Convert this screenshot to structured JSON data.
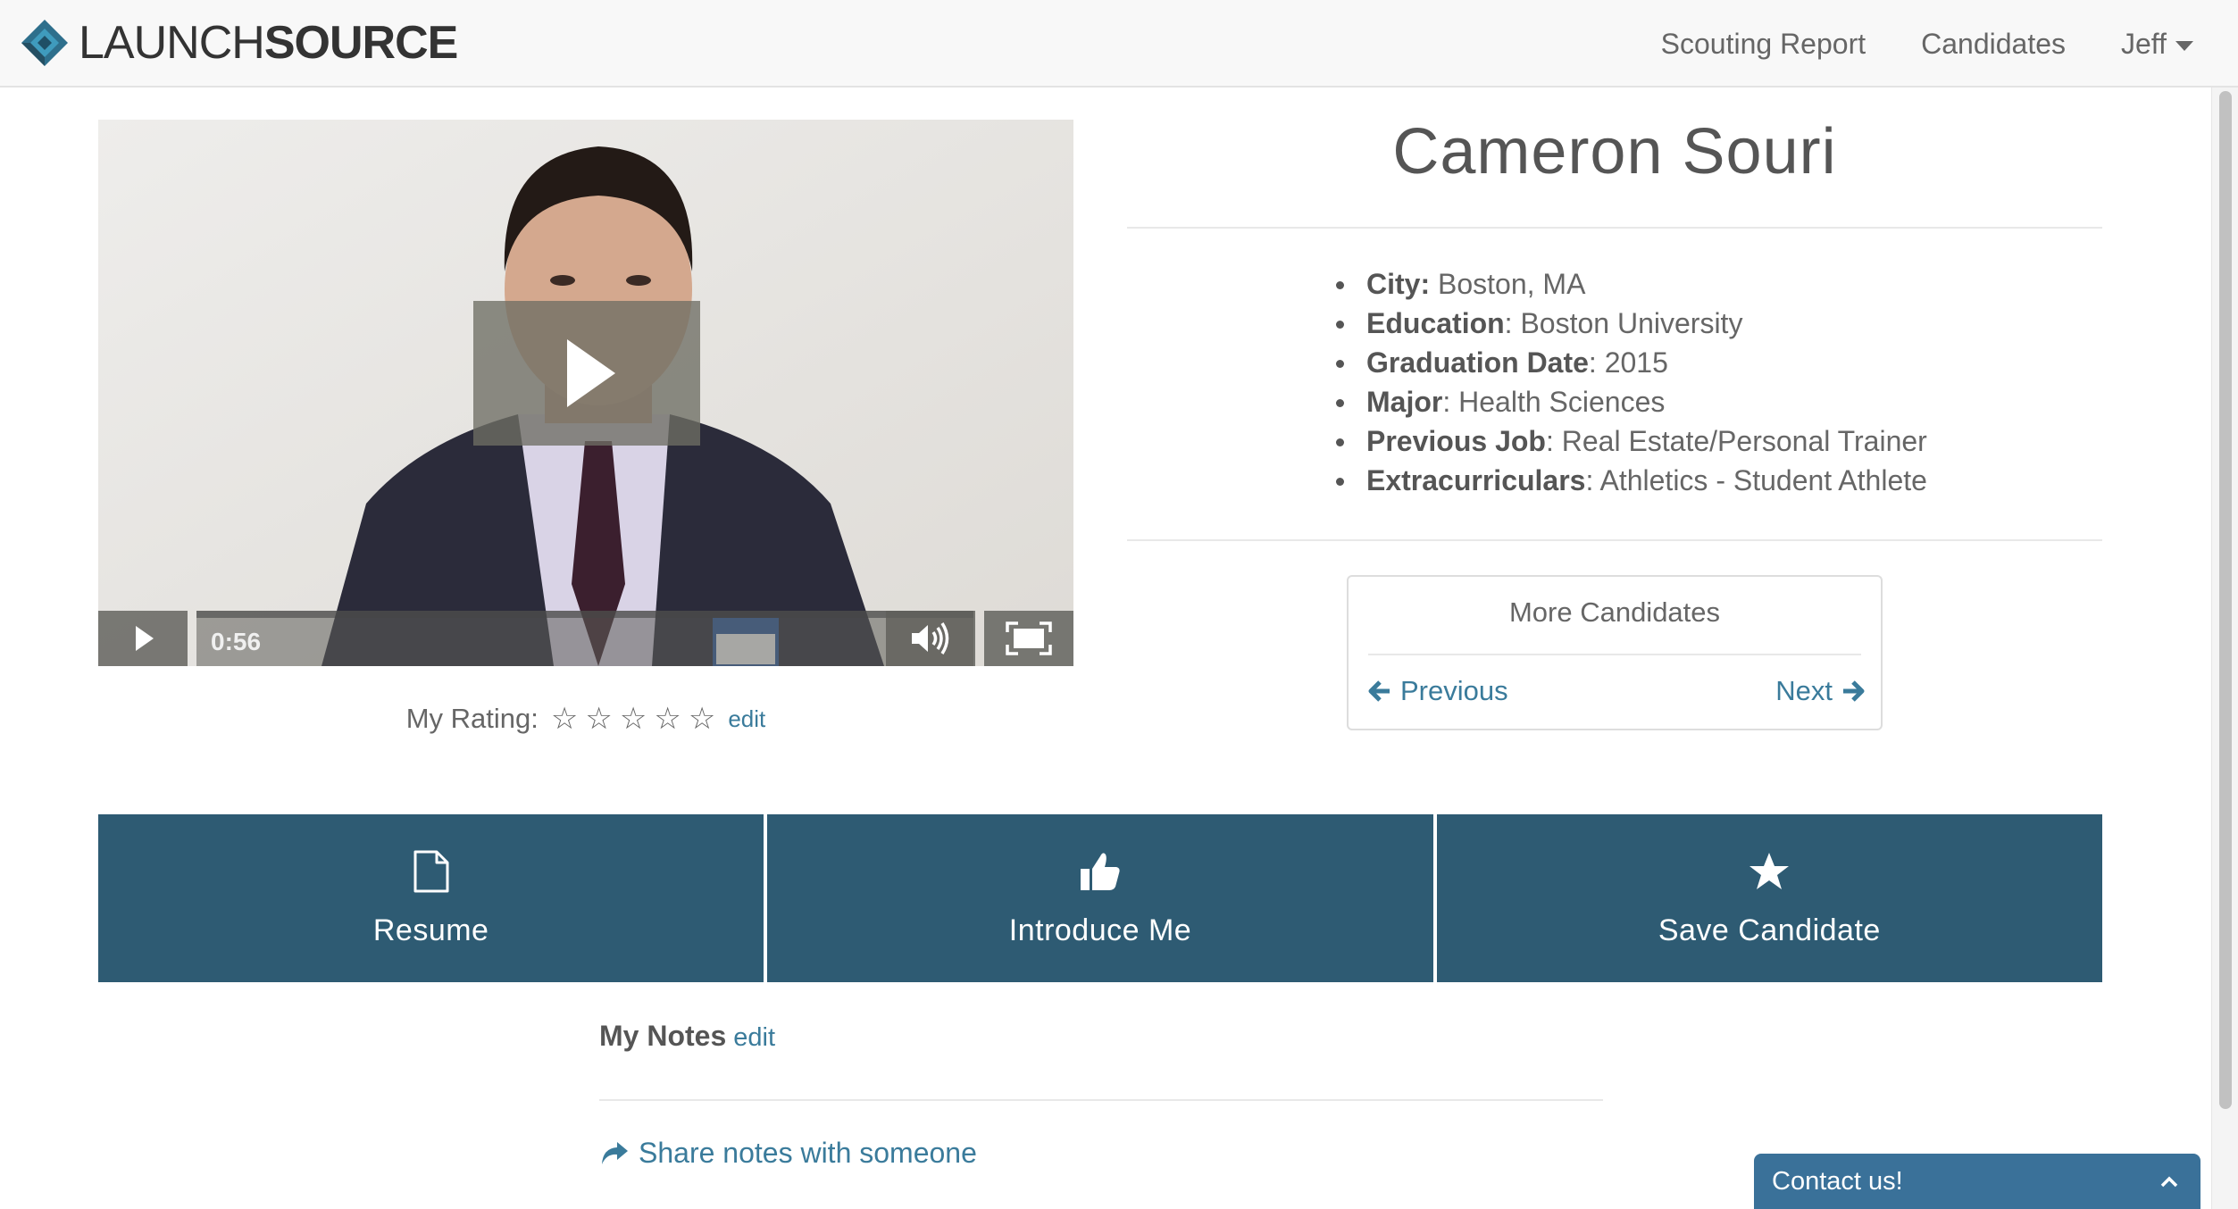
{
  "nav": {
    "logo_light": "LAUNCH",
    "logo_bold": "SOURCE",
    "links": [
      "Scouting Report",
      "Candidates"
    ],
    "user": "Jeff"
  },
  "video": {
    "time": "0:56"
  },
  "rating": {
    "label": "My Rating:",
    "stars": 0,
    "max": 5,
    "edit": "edit"
  },
  "candidate": {
    "name": "Cameron Souri",
    "details": [
      {
        "label": "City:",
        "value": " Boston, MA"
      },
      {
        "label": "Education",
        "value": ": Boston University"
      },
      {
        "label": "Graduation Date",
        "value": ": 2015"
      },
      {
        "label": "Major",
        "value": ": Health Sciences"
      },
      {
        "label": "Previous Job",
        "value": ": Real Estate/Personal Trainer"
      },
      {
        "label": "Extracurriculars",
        "value": ": Athletics - Student Athlete"
      }
    ]
  },
  "more_candidates": {
    "title": "More Candidates",
    "previous": "Previous",
    "next": "Next"
  },
  "actions": [
    {
      "label": "Resume",
      "icon": "document-icon"
    },
    {
      "label": "Introduce Me",
      "icon": "thumbs-up-icon"
    },
    {
      "label": "Save Candidate",
      "icon": "star-icon"
    }
  ],
  "notes": {
    "title": "My Notes",
    "edit": "edit",
    "share": "Share notes with someone"
  },
  "contact": {
    "label": "Contact us!"
  },
  "colors": {
    "accent": "#2e5b73",
    "link": "#3a7b9b",
    "contact": "#3a7199"
  }
}
